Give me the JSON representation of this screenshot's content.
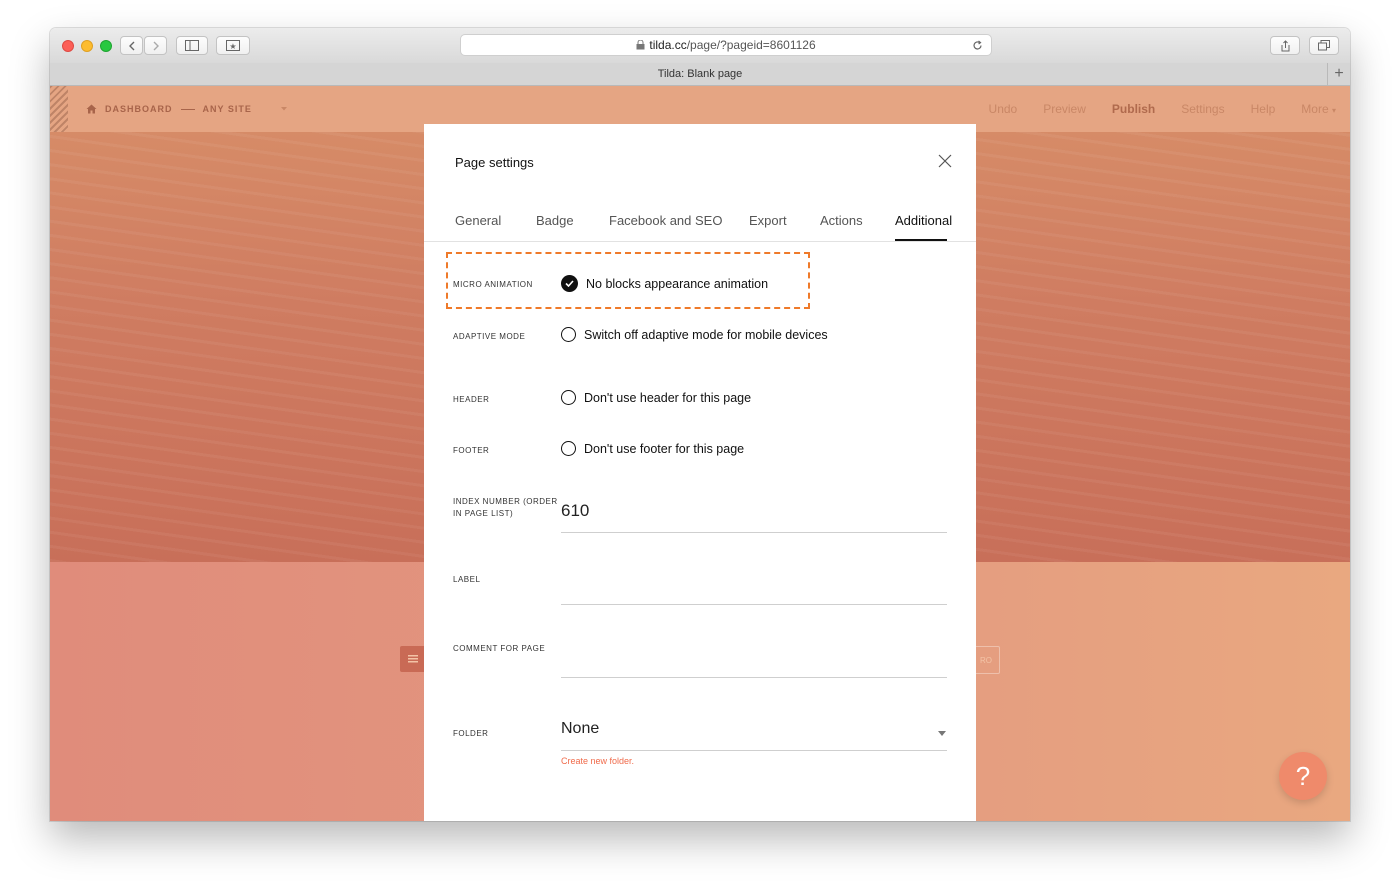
{
  "browser": {
    "url_host": "tilda.cc",
    "url_path": "/page/?pageid=8601126",
    "tab_title": "Tilda: Blank page"
  },
  "topnav": {
    "dashboard": "DASHBOARD",
    "site": "ANY SITE",
    "undo": "Undo",
    "preview": "Preview",
    "publish": "Publish",
    "settings": "Settings",
    "help": "Help",
    "more": "More"
  },
  "background": {
    "ghost_right_text": "RO",
    "help_button": "?"
  },
  "modal": {
    "title": "Page settings",
    "tabs": [
      "General",
      "Badge",
      "Facebook and SEO",
      "Export",
      "Actions",
      "Additional"
    ],
    "active_tab": "Additional",
    "micro_animation": {
      "label": "MICRO ANIMATION",
      "option": "No blocks appearance animation",
      "checked": true
    },
    "adaptive_mode": {
      "label": "ADAPTIVE MODE",
      "option": "Switch off adaptive mode for mobile devices",
      "checked": false
    },
    "header": {
      "label": "HEADER",
      "option": "Don't use header for this page",
      "checked": false
    },
    "footer": {
      "label": "FOOTER",
      "option": "Don't use footer for this page",
      "checked": false
    },
    "index_number": {
      "label_line1": "INDEX NUMBER (ORDER",
      "label_line2": "IN PAGE LIST)",
      "value": "610"
    },
    "label_field": {
      "label": "LABEL",
      "value": ""
    },
    "comment": {
      "label": "COMMENT FOR PAGE",
      "value": ""
    },
    "folder": {
      "label": "FOLDER",
      "value": "None",
      "create_link": "Create new folder."
    }
  },
  "colors": {
    "accent_dash": "#ef7a2a",
    "link": "#f06b4b",
    "help_button": "#ef8a6b"
  }
}
